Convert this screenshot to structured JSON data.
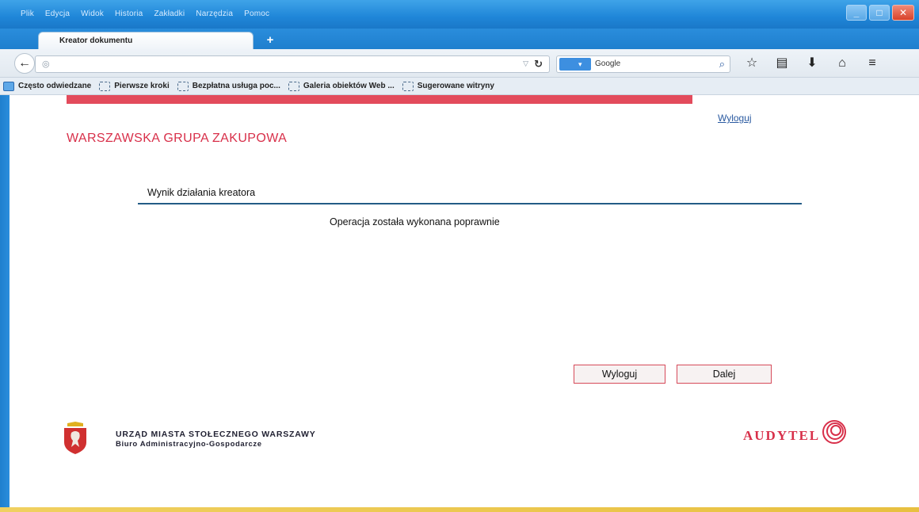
{
  "browser": {
    "menu": [
      "Plik",
      "Edycja",
      "Widok",
      "Historia",
      "Zakładki",
      "Narzędzia",
      "Pomoc"
    ],
    "tab_title": "Kreator dokumentu",
    "new_tab_label": "+",
    "search_engine": "Google",
    "bookmarks": [
      {
        "label": "Często odwiedzane",
        "icon": "folder-icon"
      },
      {
        "label": "Pierwsze kroki",
        "icon": "page-icon"
      },
      {
        "label": "Bezpłatna usługa poc...",
        "icon": "page-icon"
      },
      {
        "label": "Galeria obiektów Web ...",
        "icon": "page-icon"
      },
      {
        "label": "Sugerowane witryny",
        "icon": "page-icon"
      }
    ],
    "colors": {
      "titlebar": "#1f86d8",
      "accent_red": "#e34b5c"
    }
  },
  "page": {
    "logout_link": "Wyloguj",
    "org_title": "WARSZAWSKA GRUPA ZAKUPOWA",
    "section_title": "Wynik działania kreatora",
    "result_message": "Operacja została wykonana poprawnie",
    "buttons": {
      "logout": "Wyloguj",
      "next": "Dalej"
    },
    "footer": {
      "line1": "URZĄD MIASTA STOŁECZNEGO WARSZAWY",
      "line2": "Biuro Administracyjno-Gospodarcze",
      "brand": "AUDYTEL"
    },
    "colors": {
      "brand_red": "#d8304a",
      "link_blue": "#2a5aa0",
      "rule_blue": "#245c86"
    }
  }
}
